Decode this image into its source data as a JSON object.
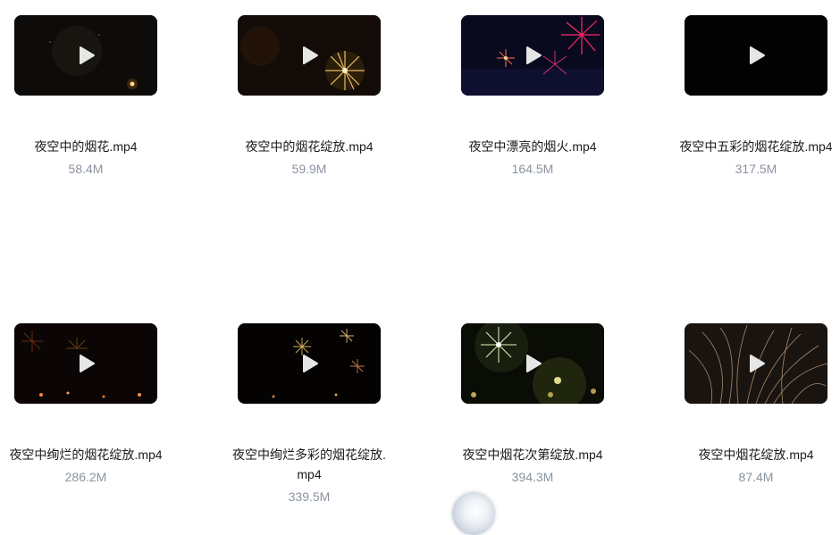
{
  "videos": [
    {
      "name": "夜空中的烟花.mp4",
      "size": "58.4M",
      "icon": "play-icon"
    },
    {
      "name": "夜空中的烟花绽放.mp4",
      "size": "59.9M",
      "icon": "play-icon"
    },
    {
      "name": "夜空中漂亮的烟火.mp4",
      "size": "164.5M",
      "icon": "play-icon"
    },
    {
      "name": "夜空中五彩的烟花绽放.mp4",
      "size": "317.5M",
      "icon": "play-icon"
    },
    {
      "name": "夜空中绚烂的烟花绽放.mp4",
      "size": "286.2M",
      "icon": "play-icon"
    },
    {
      "name": "夜空中绚烂多彩的烟花绽放.mp4",
      "size": "339.5M",
      "icon": "play-icon"
    },
    {
      "name": "夜空中烟花次第绽放.mp4",
      "size": "394.3M",
      "icon": "play-icon"
    },
    {
      "name": "夜空中烟花绽放.mp4",
      "size": "87.4M",
      "icon": "play-icon"
    }
  ],
  "colors": {
    "name_text": "#1a1a1a",
    "size_text": "#8a93a0",
    "play_icon": "#e6e6e6"
  }
}
